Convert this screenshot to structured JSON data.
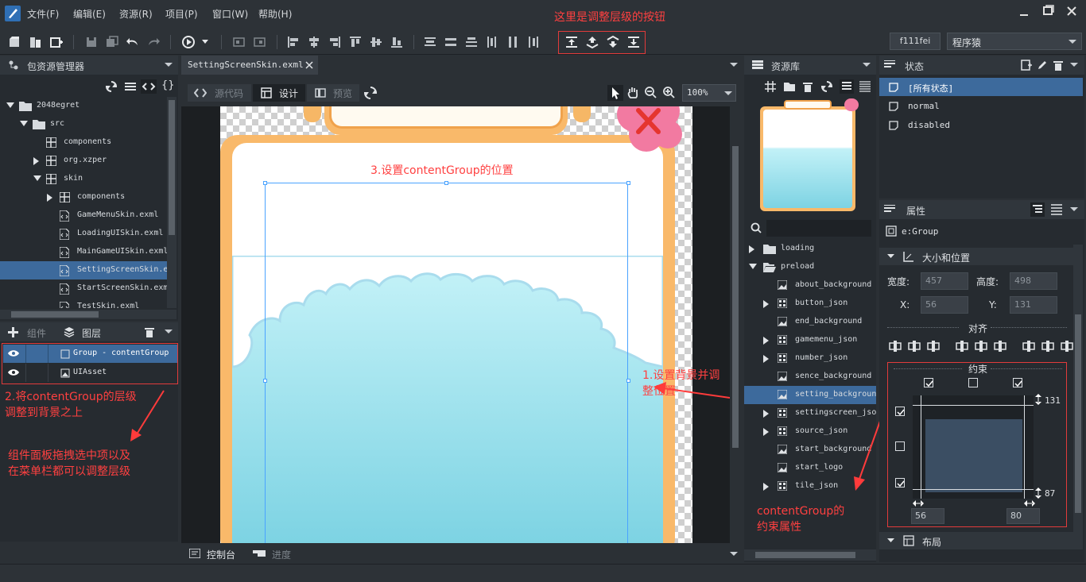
{
  "menu": [
    "文件(F)",
    "编辑(E)",
    "资源(R)",
    "项目(P)",
    "窗口(W)",
    "帮助(H)"
  ],
  "annotations": {
    "top": "这里是调整层级的按钮",
    "step1": "1.设置背景并调整位置",
    "step2_line1": "2.将contentGroup的层级",
    "step2_line2": "调整到背景之上",
    "step3": "3.设置contentGroup的位置",
    "note_line1": "组件面板拖拽选中项以及",
    "note_line2": "在菜单栏都可以调整层级",
    "constraint_line1": "contentGroup的",
    "constraint_line2": "约束属性"
  },
  "toolbar": {
    "theme_code": "f111fei",
    "user_select": "程序猿"
  },
  "package_explorer": {
    "title": "包资源管理器",
    "tree": [
      {
        "label": "2048egret",
        "depth": 0,
        "icon": "folder",
        "arrow": "down"
      },
      {
        "label": "src",
        "depth": 1,
        "icon": "folder",
        "arrow": "down"
      },
      {
        "label": "components",
        "depth": 2,
        "icon": "package",
        "arrow": ""
      },
      {
        "label": "org.xzper",
        "depth": 2,
        "icon": "package",
        "arrow": "right"
      },
      {
        "label": "skin",
        "depth": 2,
        "icon": "package",
        "arrow": "down"
      },
      {
        "label": "components",
        "depth": 3,
        "icon": "package",
        "arrow": "right"
      },
      {
        "label": "GameMenuSkin.exml",
        "depth": 3,
        "icon": "file",
        "arrow": ""
      },
      {
        "label": "LoadingUISkin.exml",
        "depth": 3,
        "icon": "file",
        "arrow": ""
      },
      {
        "label": "MainGameUISkin.exml",
        "depth": 3,
        "icon": "file",
        "arrow": ""
      },
      {
        "label": "SettingScreenSkin.exml",
        "depth": 3,
        "icon": "file",
        "arrow": "",
        "selected": true
      },
      {
        "label": "StartScreenSkin.exml",
        "depth": 3,
        "icon": "file",
        "arrow": ""
      },
      {
        "label": "TestSkin.exml",
        "depth": 3,
        "icon": "file",
        "arrow": ""
      }
    ]
  },
  "layers": {
    "tab_components": "组件",
    "tab_layers": "图层",
    "items": [
      {
        "label": "Group - contentGroup",
        "selected": true
      },
      {
        "label": "UIAsset",
        "selected": false
      }
    ]
  },
  "editor": {
    "tab": "SettingScreenSkin.exml",
    "mode_source": "源代码",
    "mode_design": "设计",
    "mode_preview": "预览",
    "zoom": "100%",
    "bottom_console": "控制台",
    "bottom_progress": "进度"
  },
  "resources": {
    "title": "资源库",
    "items": [
      {
        "label": "loading",
        "type": "folder",
        "arrow": "right",
        "depth": 0
      },
      {
        "label": "preload",
        "type": "folder-open",
        "arrow": "down",
        "depth": 0
      },
      {
        "label": "about_background",
        "type": "image",
        "arrow": "",
        "depth": 1
      },
      {
        "label": "button_json",
        "type": "sheet",
        "arrow": "right",
        "depth": 1
      },
      {
        "label": "end_background",
        "type": "image",
        "arrow": "",
        "depth": 1
      },
      {
        "label": "gamemenu_json",
        "type": "sheet",
        "arrow": "right",
        "depth": 1
      },
      {
        "label": "number_json",
        "type": "sheet",
        "arrow": "right",
        "depth": 1
      },
      {
        "label": "sence_background",
        "type": "image",
        "arrow": "",
        "depth": 1
      },
      {
        "label": "setting_background",
        "type": "image",
        "arrow": "",
        "depth": 1,
        "selected": true
      },
      {
        "label": "settingscreen_json",
        "type": "sheet",
        "arrow": "right",
        "depth": 1
      },
      {
        "label": "source_json",
        "type": "sheet",
        "arrow": "right",
        "depth": 1
      },
      {
        "label": "start_background",
        "type": "image",
        "arrow": "",
        "depth": 1
      },
      {
        "label": "start_logo",
        "type": "image",
        "arrow": "",
        "depth": 1
      },
      {
        "label": "tile_json",
        "type": "sheet",
        "arrow": "right",
        "depth": 1
      }
    ]
  },
  "states": {
    "title": "状态",
    "items": [
      {
        "label": "[所有状态]",
        "selected": true
      },
      {
        "label": "normal",
        "selected": false
      },
      {
        "label": "disabled",
        "selected": false
      }
    ]
  },
  "properties": {
    "title": "属性",
    "element": "e:Group",
    "section_size": "大小和位置",
    "width_label": "宽度:",
    "width_value": "457",
    "height_label": "高度:",
    "height_value": "498",
    "x_label": "X:",
    "x_value": "56",
    "y_label": "Y:",
    "y_value": "131",
    "align_label": "对齐",
    "constraint_label": "约束",
    "constraint_top": "131",
    "constraint_bottom": "87",
    "constraint_left": "56",
    "constraint_right": "80",
    "section_layout": "布局"
  },
  "colors": {
    "accent": "#3d6a9c",
    "annotation": "#ff4040",
    "canvas_orange": "#f9b96a",
    "sky_top": "#b6ecf5",
    "sky_bottom": "#7dd3e3"
  }
}
